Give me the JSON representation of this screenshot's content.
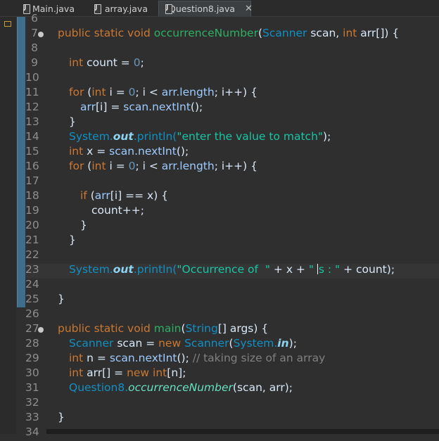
{
  "tabs": [
    {
      "label": "Main.java",
      "active": false
    },
    {
      "label": "array.java",
      "active": false
    },
    {
      "label": "Question8.java",
      "active": true
    }
  ],
  "code": {
    "l6": {
      "num": "6"
    },
    "l7": {
      "num": "7",
      "t1": "public static void ",
      "t2": "occurrenceNumber",
      "t3": "(",
      "t4": "Scanner ",
      "t5": "scan",
      "t6": ", ",
      "t7": "int ",
      "t8": "arr",
      "t9": "[]) {"
    },
    "l8": {
      "num": "8"
    },
    "l9": {
      "num": "9",
      "t1": "int ",
      "t2": "count",
      "t3": " = ",
      "t4": "0",
      "t5": ";"
    },
    "l10": {
      "num": "10"
    },
    "l11": {
      "num": "11",
      "t1": "for ",
      "t2": "(",
      "t3": "int ",
      "t4": "i",
      "t5": " = ",
      "t6": "0",
      "t7": "; ",
      "t8": "i",
      "t9": " < ",
      "t10": "arr.length",
      "t11": "; ",
      "t12": "i",
      "t13": "++) {"
    },
    "l12": {
      "num": "12",
      "t1": "arr",
      "t2": "[",
      "t3": "i",
      "t4": "] = ",
      "t5": "scan.nextInt",
      "t6": "();"
    },
    "l13": {
      "num": "13",
      "t1": "}"
    },
    "l14": {
      "num": "14",
      "t1": "System.",
      "t2": "out",
      "t3": ".println(",
      "t4": "\"enter the value to match\"",
      "t5": ");"
    },
    "l15": {
      "num": "15",
      "t1": "int ",
      "t2": "x",
      "t3": " = ",
      "t4": "scan.nextInt",
      "t5": "();"
    },
    "l16": {
      "num": "16",
      "t1": "for ",
      "t2": "(",
      "t3": "int ",
      "t4": "i",
      "t5": " = ",
      "t6": "0",
      "t7": "; ",
      "t8": "i",
      "t9": " < ",
      "t10": "arr.length",
      "t11": "; ",
      "t12": "i",
      "t13": "++) {"
    },
    "l17": {
      "num": "17"
    },
    "l18": {
      "num": "18",
      "t1": "if ",
      "t2": "(",
      "t3": "arr",
      "t4": "[",
      "t5": "i",
      "t6": "] == ",
      "t7": "x",
      "t8": ") {"
    },
    "l19": {
      "num": "19",
      "t1": "count",
      "t2": "++;"
    },
    "l20": {
      "num": "20",
      "t1": "}"
    },
    "l21": {
      "num": "21",
      "t1": "}"
    },
    "l22": {
      "num": "22"
    },
    "l23": {
      "num": "23",
      "t1": "System.",
      "t2": "out",
      "t3": ".println(",
      "t4": "\"Occurrence of  \"",
      "t5": " + ",
      "t6": "x",
      "t7": " + ",
      "t8": "\" ",
      "t9": "s : \"",
      "t10": " + ",
      "t11": "count",
      "t12": ");"
    },
    "l24": {
      "num": "24"
    },
    "l25": {
      "num": "25",
      "t1": "}"
    },
    "l26": {
      "num": "26"
    },
    "l27": {
      "num": "27",
      "t1": "public static void ",
      "t2": "main",
      "t3": "(",
      "t4": "String",
      "t5": "[] ",
      "t6": "args",
      "t7": ") {"
    },
    "l28": {
      "num": "28",
      "t1": "Scanner ",
      "t2": "scan",
      "t3": " = ",
      "t4": "new ",
      "t5": "Scanner",
      "t6": "(",
      "t7": "System.",
      "t8": "in",
      "t9": ");"
    },
    "l29": {
      "num": "29",
      "t1": "int ",
      "t2": "n",
      "t3": " = ",
      "t4": "scan.nextInt",
      "t5": "(); ",
      "t6": "// taking size of an array"
    },
    "l30": {
      "num": "30",
      "t1": "int ",
      "t2": "arr",
      "t3": "[] = ",
      "t4": "new ",
      "t5": "int",
      "t6": "[",
      "t7": "n",
      "t8": "];"
    },
    "l31": {
      "num": "31",
      "t1": "Question8.",
      "t2": "occurrenceNumber",
      "t3": "(",
      "t4": "scan",
      "t5": ", ",
      "t6": "arr",
      "t7": ");"
    },
    "l32": {
      "num": "32"
    },
    "l33": {
      "num": "33",
      "t1": "}"
    },
    "l34": {
      "num": "34"
    }
  }
}
